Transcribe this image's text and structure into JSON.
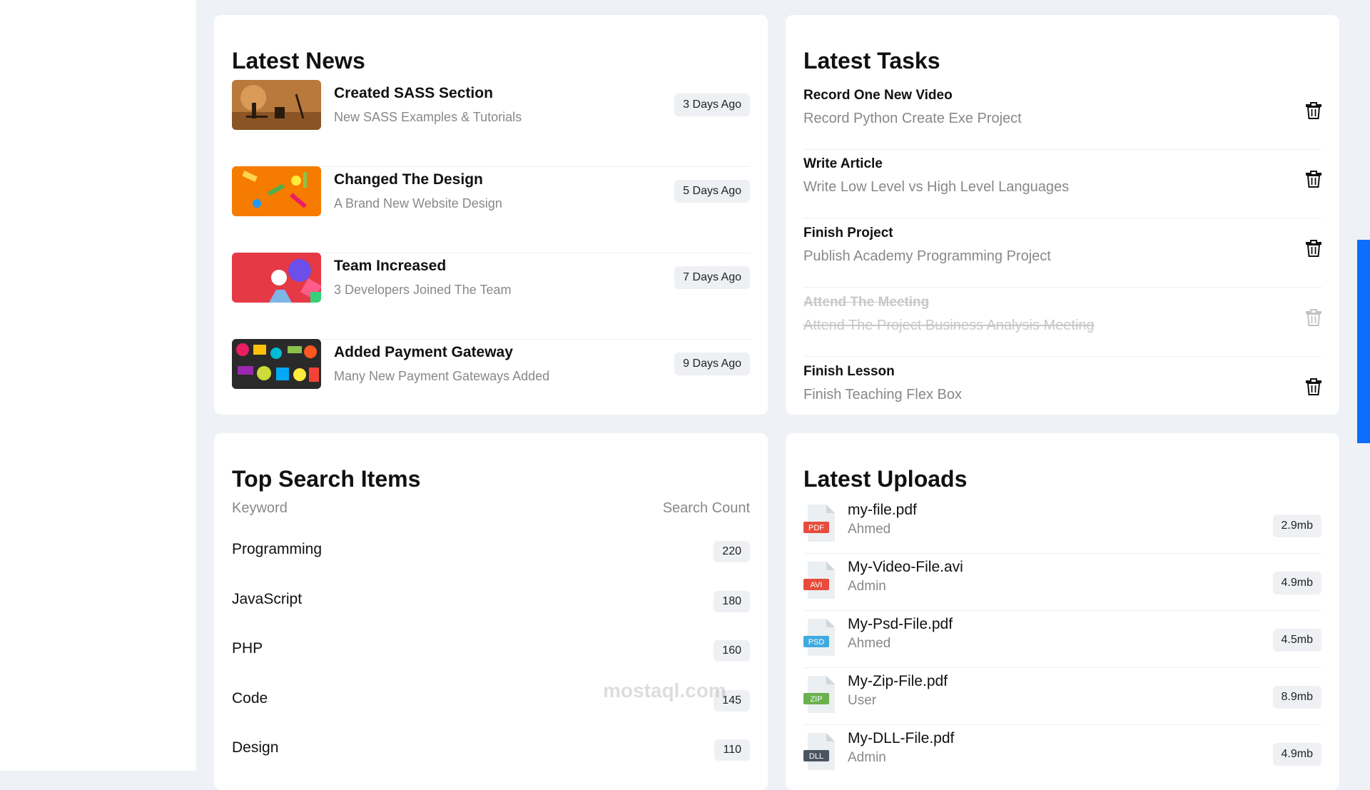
{
  "news": {
    "title": "Latest News",
    "items": [
      {
        "title": "Created SASS Section",
        "subtitle": "New SASS Examples & Tutorials",
        "age": "3 Days Ago"
      },
      {
        "title": "Changed The Design",
        "subtitle": "A Brand New Website Design",
        "age": "5 Days Ago"
      },
      {
        "title": "Team Increased",
        "subtitle": "3 Developers Joined The Team",
        "age": "7 Days Ago"
      },
      {
        "title": "Added Payment Gateway",
        "subtitle": "Many New Payment Gateways Added",
        "age": "9 Days Ago"
      }
    ]
  },
  "tasks": {
    "title": "Latest Tasks",
    "items": [
      {
        "title": "Record One New Video",
        "subtitle": "Record Python Create Exe Project",
        "done": false
      },
      {
        "title": "Write Article",
        "subtitle": "Write Low Level vs High Level Languages",
        "done": false
      },
      {
        "title": "Finish Project",
        "subtitle": "Publish Academy Programming Project",
        "done": false
      },
      {
        "title": "Attend The Meeting",
        "subtitle": "Attend The Project Business Analysis Meeting",
        "done": true
      },
      {
        "title": "Finish Lesson",
        "subtitle": "Finish Teaching Flex Box",
        "done": false
      }
    ]
  },
  "search": {
    "title": "Top Search Items",
    "col_keyword": "Keyword",
    "col_count": "Search Count",
    "items": [
      {
        "keyword": "Programming",
        "count": "220"
      },
      {
        "keyword": "JavaScript",
        "count": "180"
      },
      {
        "keyword": "PHP",
        "count": "160"
      },
      {
        "keyword": "Code",
        "count": "145"
      },
      {
        "keyword": "Design",
        "count": "110"
      }
    ]
  },
  "uploads": {
    "title": "Latest Uploads",
    "items": [
      {
        "name": "my-file.pdf",
        "user": "Ahmed",
        "size": "2.9mb",
        "type": "PDF",
        "color": "#e74c3c"
      },
      {
        "name": "My-Video-File.avi",
        "user": "Admin",
        "size": "4.9mb",
        "type": "AVI",
        "color": "#e74c3c"
      },
      {
        "name": "My-Psd-File.pdf",
        "user": "Ahmed",
        "size": "4.5mb",
        "type": "PSD",
        "color": "#3fa9e0"
      },
      {
        "name": "My-Zip-File.pdf",
        "user": "User",
        "size": "8.9mb",
        "type": "ZIP",
        "color": "#6ab04c"
      },
      {
        "name": "My-DLL-File.pdf",
        "user": "Admin",
        "size": "4.9mb",
        "type": "DLL",
        "color": "#4a5560"
      }
    ]
  },
  "watermark": {
    "text": "mostaql.com"
  },
  "colors": {
    "accent": "#0d6efd",
    "badge_bg": "#eef0f3",
    "muted": "#888888"
  }
}
